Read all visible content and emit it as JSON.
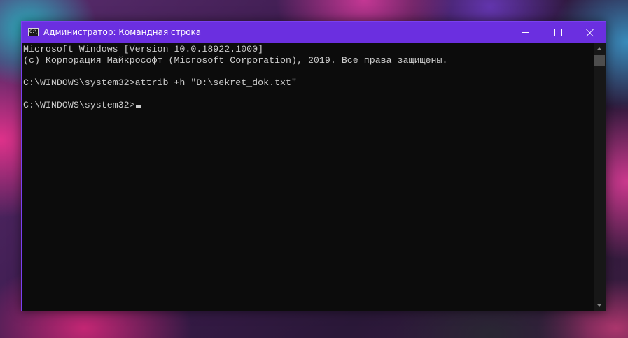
{
  "window": {
    "title": "Администратор: Командная строка",
    "icon": "cmd-icon",
    "icon_label": "C:\\",
    "accent_color": "#6b2fe0"
  },
  "caption_buttons": {
    "minimize_icon": "minimize-icon",
    "maximize_icon": "maximize-icon",
    "close_icon": "close-icon"
  },
  "console": {
    "lines": [
      "Microsoft Windows [Version 10.0.18922.1000]",
      "(c) Корпорация Майкрософт (Microsoft Corporation), 2019. Все права защищены.",
      "C:\\WINDOWS\\system32>attrib +h \"D:\\sekret_dok.txt\"",
      "C:\\WINDOWS\\system32>"
    ],
    "text_color": "#cccccc",
    "background_color": "#0c0c0c"
  }
}
